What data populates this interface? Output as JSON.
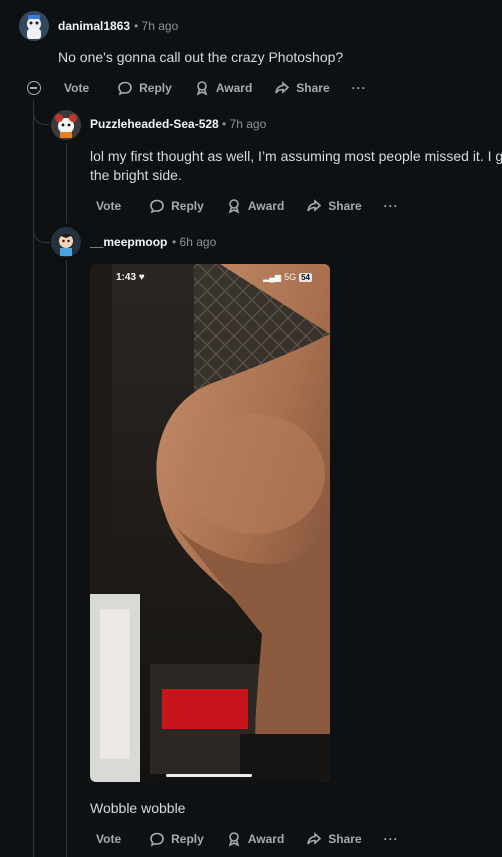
{
  "comments": [
    {
      "username": "danimal1863",
      "time": "7h ago",
      "text": "No one's gonna call out the crazy Photoshop?"
    },
    {
      "username": "Puzzleheaded-Sea-528",
      "time": "7h ago",
      "text_line1": "lol my first thought as well, I’m assuming most people missed it. I g",
      "text_line2": "the bright side."
    },
    {
      "username": "__meepmoop",
      "time": "6h ago",
      "text": "Wobble wobble",
      "image_status": {
        "time": "1:43",
        "network": "5G",
        "battery": "54"
      }
    }
  ],
  "actions": {
    "vote": "Vote",
    "reply": "Reply",
    "award": "Award",
    "share": "Share",
    "more": "···"
  },
  "separator": "•",
  "colors": {
    "background": "#0e1113",
    "text": "#d7dadc",
    "meta": "#8b9498",
    "thread_line": "#343536"
  }
}
